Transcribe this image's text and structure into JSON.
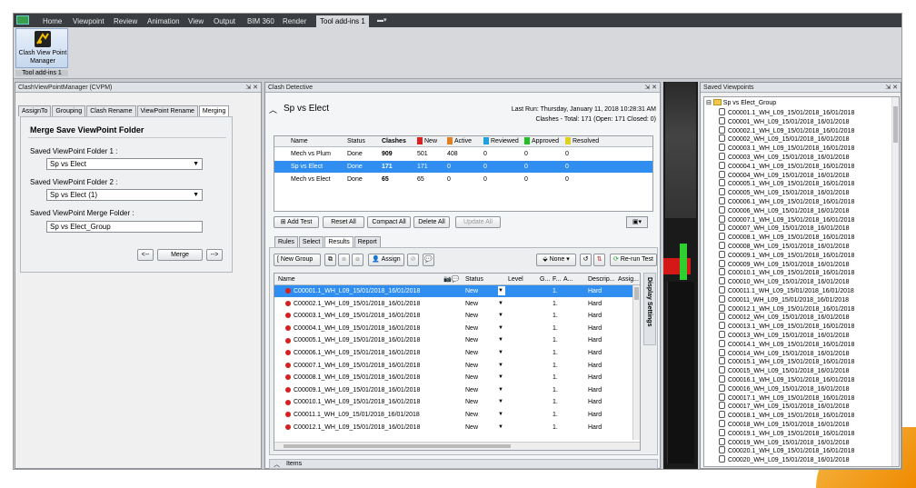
{
  "ribbon": {
    "tabs": [
      "Home",
      "Viewpoint",
      "Review",
      "Animation",
      "View",
      "Output",
      "BIM 360",
      "Render",
      "Tool add-ins 1"
    ],
    "tool_label": "Clash View Point Manager",
    "group_label": "Tool add-ins 1"
  },
  "cvpm": {
    "title": "ClashViewPointManager (CVPM)",
    "tabs": [
      "AssignTo",
      "Grouping",
      "Clash Rename",
      "ViewPoint Rename",
      "Merging"
    ],
    "heading": "Merge Save ViewPoint Folder",
    "folder1_label": "Saved ViewPoint Folder 1 :",
    "folder1_value": "Sp vs Elect",
    "folder2_label": "Saved ViewPoint Folder 2 :",
    "folder2_value": "Sp vs Elect (1)",
    "merge_label": "Saved ViewPoint Merge Folder :",
    "merge_value": "Sp vs Elect_Group",
    "prev_btn": "<--",
    "merge_btn": "Merge",
    "next_btn": "-->"
  },
  "clash": {
    "title": "Clash Detective",
    "test_name": "Sp vs Elect",
    "last_run": "Last Run:  Thursday, January 11, 2018 10:28:31 AM",
    "summary": "Clashes -  Total:  171  (Open:  171  Closed:  0)",
    "columns": [
      "Name",
      "Status",
      "Clashes",
      "New",
      "Active",
      "Reviewed",
      "Approved",
      "Resolved"
    ],
    "column_colors": [
      "",
      "",
      "",
      "#e02020",
      "#e08020",
      "#20a0e0",
      "#20c020",
      "#e0d020"
    ],
    "tests": [
      [
        "Mech vs Plum",
        "Done",
        "909",
        "501",
        "408",
        "0",
        "0",
        "0"
      ],
      [
        "Sp vs Elect",
        "Done",
        "171",
        "171",
        "0",
        "0",
        "0",
        "0"
      ],
      [
        "Mech vs Elect",
        "Done",
        "65",
        "65",
        "0",
        "0",
        "0",
        "0"
      ]
    ],
    "buttons": [
      "Add Test",
      "Reset All",
      "Compact All",
      "Delete All",
      "Update All"
    ],
    "subtabs": [
      "Rules",
      "Select",
      "Results",
      "Report"
    ],
    "toolbar": {
      "new_group": "New Group",
      "assign": "Assign",
      "none": "None",
      "rerun": "Re-run Test"
    },
    "res_columns": [
      "Name",
      "Status",
      "Level",
      "G...",
      "F...",
      "A...",
      "Descrip...",
      "Assig..."
    ],
    "results": [
      "C00001.1_WH_L09_15/01/2018_16/01/2018",
      "C00002.1_WH_L09_15/01/2018_16/01/2018",
      "C00003.1_WH_L09_15/01/2018_16/01/2018",
      "C00004.1_WH_L09_15/01/2018_16/01/2018",
      "C00005.1_WH_L09_15/01/2018_16/01/2018",
      "C00006.1_WH_L09_15/01/2018_16/01/2018",
      "C00007.1_WH_L09_15/01/2018_16/01/2018",
      "C00008.1_WH_L09_15/01/2018_16/01/2018",
      "C00009.1_WH_L09_15/01/2018_16/01/2018",
      "C00010.1_WH_L09_15/01/2018_16/01/2018",
      "C00011.1_WH_L09_15/01/2018_16/01/2018",
      "C00012.1_WH_L09_15/01/2018_16/01/2018"
    ],
    "result_status": "New",
    "result_f": "1.",
    "result_desc": "Hard",
    "display_settings": "Display Settings",
    "items_label": "Items"
  },
  "saved_viewpoints": {
    "title": "Saved Viewpoints",
    "folder": "Sp vs Elect_Group",
    "items": [
      "C00001.1_WH_L09_15/01/2018_16/01/2018",
      "C00001_WH_L09_15/01/2018_16/01/2018",
      "C00002.1_WH_L09_15/01/2018_16/01/2018",
      "C00002_WH_L09_15/01/2018_16/01/2018",
      "C00003.1_WH_L09_15/01/2018_16/01/2018",
      "C00003_WH_L09_15/01/2018_16/01/2018",
      "C00004.1_WH_L09_15/01/2018_16/01/2018",
      "C00004_WH_L09_15/01/2018_16/01/2018",
      "C00005.1_WH_L09_15/01/2018_16/01/2018",
      "C00005_WH_L09_15/01/2018_16/01/2018",
      "C00006.1_WH_L09_15/01/2018_16/01/2018",
      "C00006_WH_L09_15/01/2018_16/01/2018",
      "C00007.1_WH_L09_15/01/2018_16/01/2018",
      "C00007_WH_L09_15/01/2018_16/01/2018",
      "C00008.1_WH_L09_15/01/2018_16/01/2018",
      "C00008_WH_L09_15/01/2018_16/01/2018",
      "C00009.1_WH_L09_15/01/2018_16/01/2018",
      "C00009_WH_L09_15/01/2018_16/01/2018",
      "C00010.1_WH_L09_15/01/2018_16/01/2018",
      "C00010_WH_L09_15/01/2018_16/01/2018",
      "C00011.1_WH_L09_15/01/2018_16/01/2018",
      "C00011_WH_L09_15/01/2018_16/01/2018",
      "C00012.1_WH_L09_15/01/2018_16/01/2018",
      "C00012_WH_L09_15/01/2018_16/01/2018",
      "C00013.1_WH_L09_15/01/2018_16/01/2018",
      "C00013_WH_L09_15/01/2018_16/01/2018",
      "C00014.1_WH_L09_15/01/2018_16/01/2018",
      "C00014_WH_L09_15/01/2018_16/01/2018",
      "C00015.1_WH_L09_15/01/2018_16/01/2018",
      "C00015_WH_L09_15/01/2018_16/01/2018",
      "C00016.1_WH_L09_15/01/2018_16/01/2018",
      "C00016_WH_L09_15/01/2018_16/01/2018",
      "C00017.1_WH_L09_15/01/2018_16/01/2018",
      "C00017_WH_L09_15/01/2018_16/01/2018",
      "C00018.1_WH_L09_15/01/2018_16/01/2018",
      "C00018_WH_L09_15/01/2018_16/01/2018",
      "C00019.1_WH_L09_15/01/2018_16/01/2018",
      "C00019_WH_L09_15/01/2018_16/01/2018",
      "C00020.1_WH_L09_15/01/2018_16/01/2018",
      "C00020_WH_L09_15/01/2018_16/01/2018"
    ]
  }
}
